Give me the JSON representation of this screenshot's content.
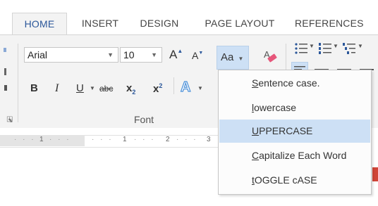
{
  "tabs": [
    {
      "label": "HOME",
      "active": true
    },
    {
      "label": "INSERT",
      "active": false
    },
    {
      "label": "DESIGN",
      "active": false
    },
    {
      "label": "PAGE LAYOUT",
      "active": false
    },
    {
      "label": "REFERENCES",
      "active": false
    }
  ],
  "font": {
    "name": "Arial",
    "size": "10",
    "grow_glyph": "A",
    "shrink_glyph": "A",
    "case_label": "Aa",
    "group_label": "Font",
    "bold": "B",
    "italic": "I",
    "underline": "U",
    "strike": "abc",
    "subscript_base": "x",
    "subscript_mark": "2",
    "superscript_base": "x",
    "superscript_mark": "2",
    "effects": "A"
  },
  "ruler": {
    "labels": [
      "1",
      "1",
      "2",
      "3"
    ]
  },
  "change_case_menu": {
    "items": [
      {
        "accel": "S",
        "rest": "entence case.",
        "highlighted": false
      },
      {
        "accel": "l",
        "rest": "owercase",
        "highlighted": false
      },
      {
        "accel": "U",
        "rest": "PPERCASE",
        "highlighted": true
      },
      {
        "accel": "C",
        "rest": "apitalize Each Word",
        "highlighted": false
      },
      {
        "accel": "t",
        "rest": "OGGLE cASE",
        "highlighted": false
      }
    ]
  },
  "colors": {
    "accent": "#2b579a",
    "highlight": "#cde0f5",
    "ribbon_bg": "#f3f3f3"
  }
}
